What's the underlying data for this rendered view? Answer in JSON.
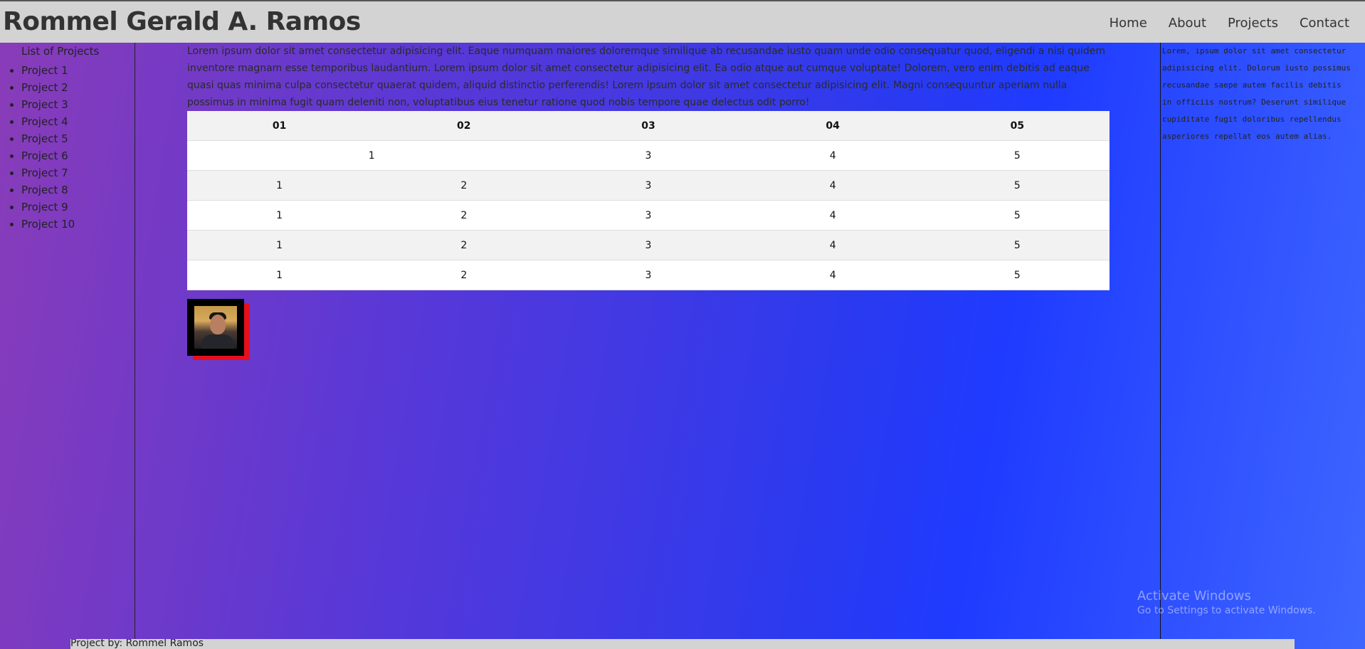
{
  "header": {
    "title": "Rommel Gerald A. Ramos",
    "nav": [
      "Home",
      "About",
      "Projects",
      "Contact"
    ]
  },
  "sidebar": {
    "heading": "List of Projects",
    "items": [
      "Project 1",
      "Project 2",
      "Project 3",
      "Project 4",
      "Project 5",
      "Project 6",
      "Project 7",
      "Project 8",
      "Project 9",
      "Project 10"
    ]
  },
  "main": {
    "intro": "Lorem ipsum dolor sit amet consectetur adipisicing elit. Eaque numquam maiores doloremque similique ab recusandae iusto quam unde odio consequatur quod, eligendi a nisi quidem inventore magnam esse temporibus laudantium. Lorem ipsum dolor sit amet consectetur adipisicing elit. Ea odio atque aut cumque voluptate! Dolorem, vero enim debitis ad eaque quasi quas minima culpa consectetur quaerat quidem, aliquid distinctio perferendis! Lorem ipsum dolor sit amet consectetur adipisicing elit. Magni consequuntur aperiam nulla possimus in minima fugit quam deleniti non, voluptatibus eius tenetur ratione quod nobis tempore quae delectus odit porro!",
    "table": {
      "headers": [
        "01",
        "02",
        "03",
        "04",
        "05"
      ],
      "rows": [
        [
          "1",
          "",
          "3",
          "4",
          "5"
        ],
        [
          "1",
          "2",
          "3",
          "4",
          "5"
        ],
        [
          "1",
          "2",
          "3",
          "4",
          "5"
        ],
        [
          "1",
          "2",
          "3",
          "4",
          "5"
        ],
        [
          "1",
          "2",
          "3",
          "4",
          "5"
        ]
      ]
    },
    "photo_icon": "profile-photo"
  },
  "right": {
    "text": "Lorem, ipsum dolor sit amet consectetur adipisicing elit. Dolorum iusto possimus recusandae saepe autem facilis debitis in officiis nostrum? Deserunt similique cupiditate fugit doloribus repellendus asperiores repellat eos autem alias."
  },
  "watermark": {
    "title": "Activate Windows",
    "subtitle": "Go to Settings to activate Windows."
  },
  "footer": {
    "text": "Project by: Rommel Ramos"
  },
  "colors": {
    "header_bg": "#d3d3d3",
    "gradient_start": "#8a3cb8",
    "gradient_mid": "#1f3bff",
    "gradient_end": "#3e66ff",
    "photo_shadow": "#e6101d"
  }
}
